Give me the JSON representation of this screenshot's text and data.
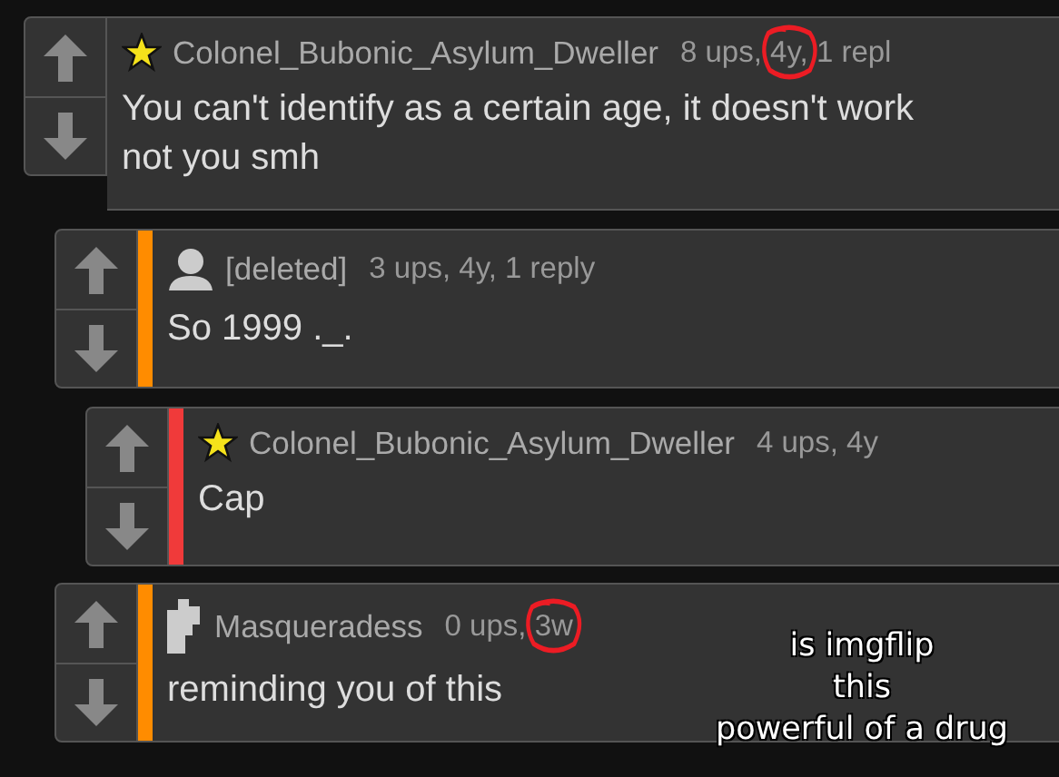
{
  "comments": [
    {
      "author": "Colonel_Bubonic_Asylum_Dweller",
      "kind": "star",
      "meta_parts": [
        {
          "text": "8 ups,",
          "circled": false
        },
        {
          "text": "4y,",
          "circled": true
        },
        {
          "text": "1 repl",
          "circled": false
        }
      ],
      "body_lines": [
        "You can't identify as a certain age, it doesn't work",
        "not you smh"
      ],
      "children": [
        {
          "author": "[deleted]",
          "kind": "person",
          "color": "#ff8c00",
          "meta_parts": [
            {
              "text": "3 ups, 4y, 1 reply",
              "circled": false
            }
          ],
          "body_lines": [
            "So 1999 ._."
          ],
          "children": [
            {
              "author": "Colonel_Bubonic_Asylum_Dweller",
              "kind": "star",
              "color": "#f03a3a",
              "meta_parts": [
                {
                  "text": "4 ups, 4y",
                  "circled": false
                }
              ],
              "body_lines": [
                "Cap"
              ]
            }
          ]
        },
        {
          "author": "Masqueradess",
          "kind": "blocky",
          "color": "#ff8c00",
          "meta_parts": [
            {
              "text": "0 ups,",
              "circled": false
            },
            {
              "text": "3w",
              "circled": true
            }
          ],
          "body_lines": [
            "reminding you of this"
          ]
        }
      ]
    }
  ],
  "caption_lines": [
    "is imgflip",
    "this",
    "powerful of a drug"
  ]
}
